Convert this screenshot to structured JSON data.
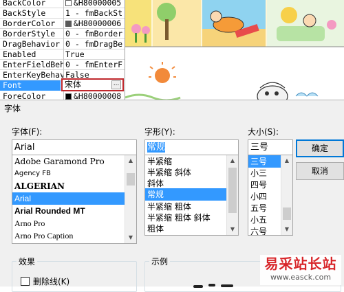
{
  "properties": {
    "rows": [
      {
        "name": "BackColor",
        "value": "&H80000005",
        "swatch": "#ffffff"
      },
      {
        "name": "BackStyle",
        "value": "1 - fmBackSt",
        "swatch": ""
      },
      {
        "name": "BorderColor",
        "value": "&H80000006",
        "swatch": "#5a5a5a"
      },
      {
        "name": "BorderStyle",
        "value": "0 - fmBorder",
        "swatch": ""
      },
      {
        "name": "DragBehavior",
        "value": "0 - fmDragBe",
        "swatch": ""
      },
      {
        "name": "Enabled",
        "value": "True",
        "swatch": ""
      },
      {
        "name": "EnterFieldBeh",
        "value": "0 - fmEnterF",
        "swatch": ""
      },
      {
        "name": "EnterKeyBehav",
        "value": "False",
        "swatch": ""
      },
      {
        "name": "Font",
        "value": "宋体",
        "swatch": ""
      },
      {
        "name": "ForeColor",
        "value": "&H80000008",
        "swatch": "#000000"
      }
    ],
    "font_button": "..."
  },
  "dialog": {
    "title": "字体",
    "font_label": "字体(F):",
    "style_label": "字形(Y):",
    "size_label": "大小(S):",
    "font_value": "Arial",
    "style_value": "常规",
    "size_value": "三号",
    "font_list": [
      "Adobe Garamond Pro",
      "Agency FB",
      "ALGERIAN",
      "Arial",
      "Arial Rounded MT",
      "Arno Pro",
      "Arno Pro Caption"
    ],
    "font_list_selected": 3,
    "style_list": [
      "半紧缩",
      "半紧缩 斜体",
      "斜体",
      "常规",
      "半紧缩 粗体",
      "半紧缩 粗体 斜体",
      "粗体"
    ],
    "style_list_selected": 3,
    "size_list": [
      "三号",
      "小三",
      "四号",
      "小四",
      "五号",
      "小五",
      "六号"
    ],
    "size_list_selected": 0,
    "ok_button": "确定",
    "cancel_button": "取消",
    "effects_label": "效果",
    "strikeout_label": "删除线(K)",
    "sample_label": "示例"
  },
  "watermark": {
    "main": "易采站长站",
    "url": "www.easck.com"
  },
  "colors": {
    "selection": "#3399ff",
    "highlight_box": "#c0282d",
    "dialog_bg": "#f0f0f0",
    "watermark_red": "#d8262a"
  }
}
